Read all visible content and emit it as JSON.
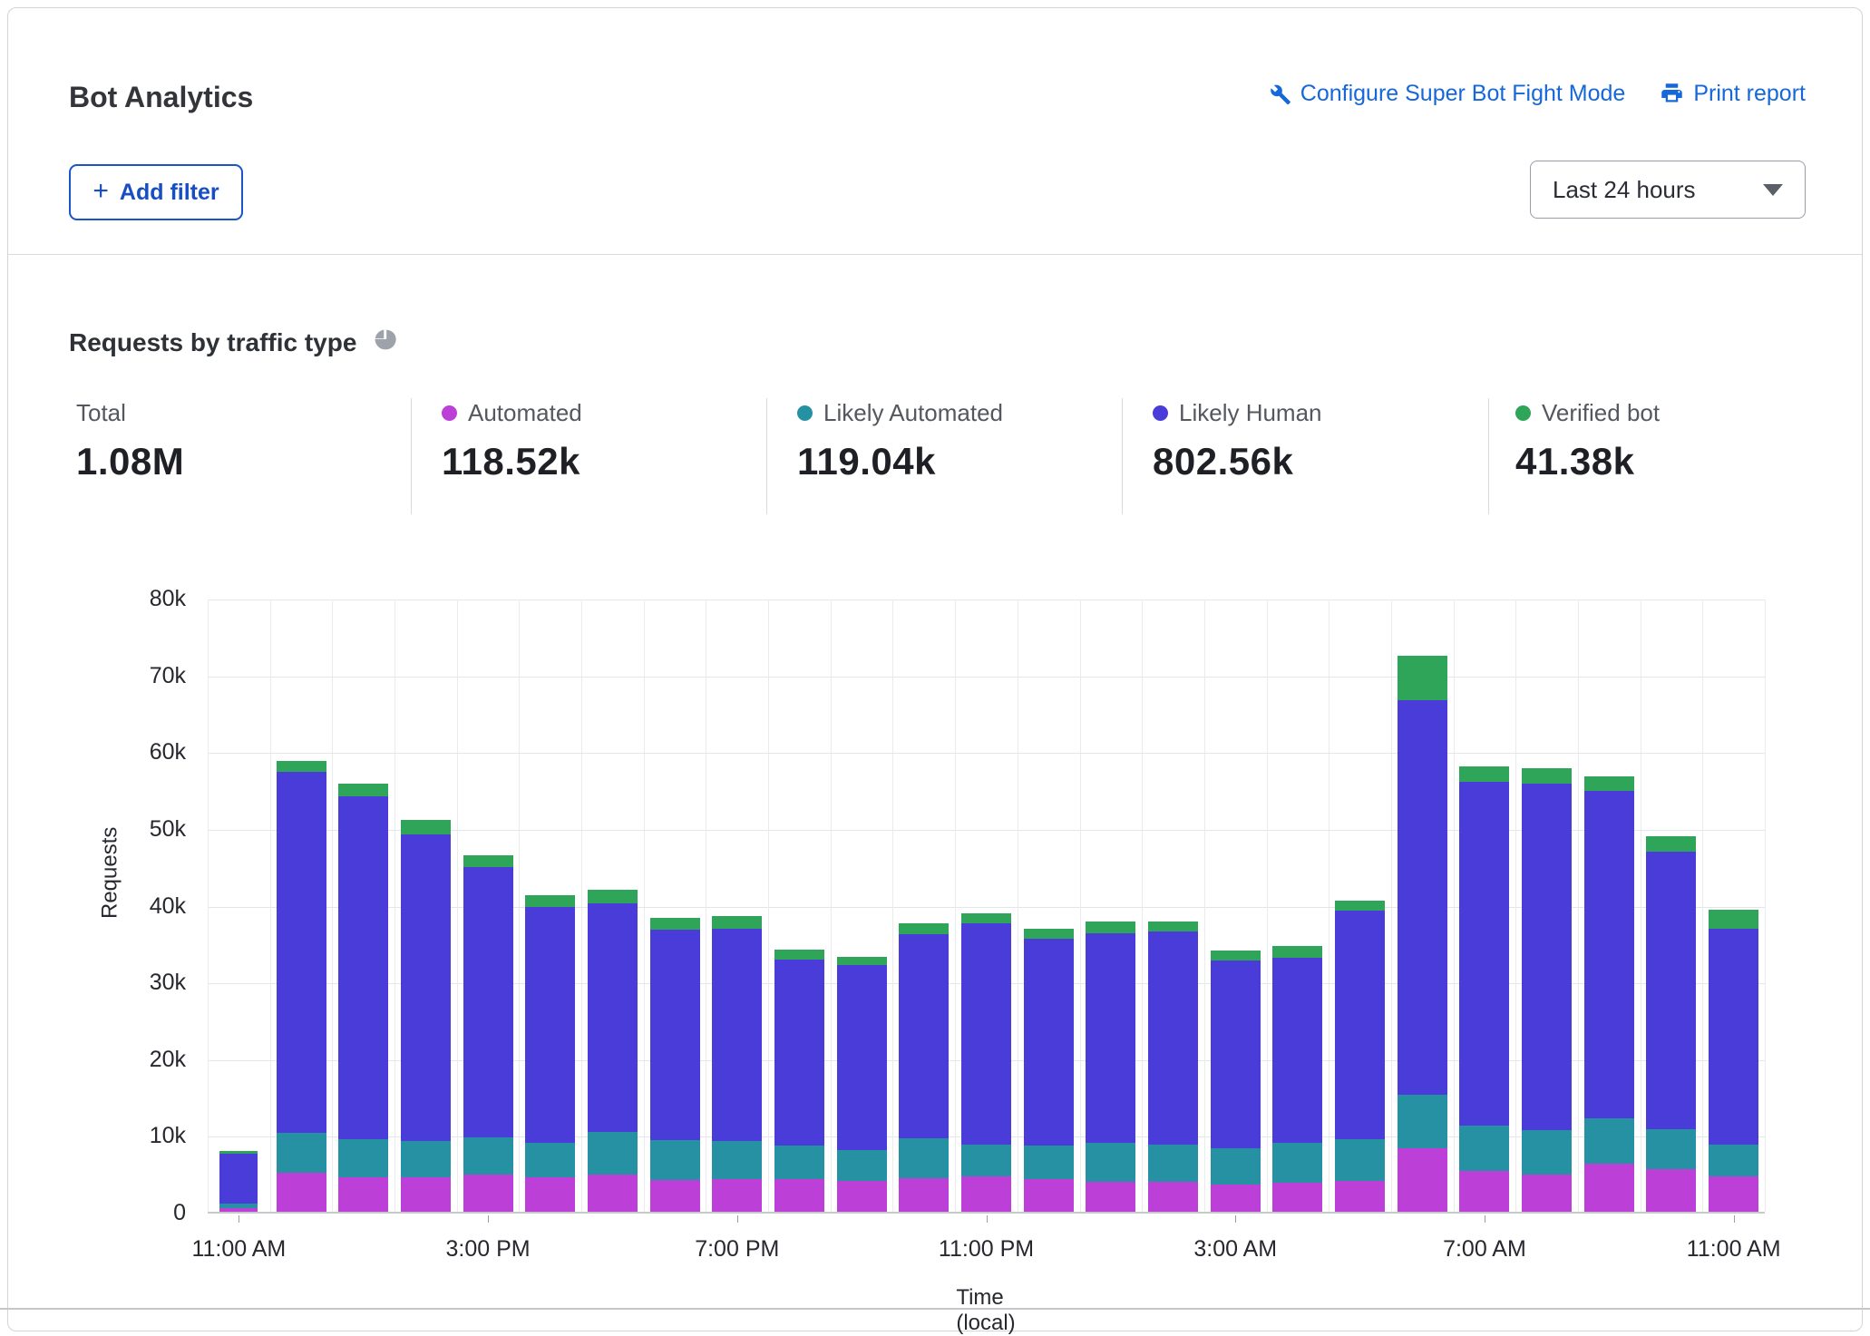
{
  "header": {
    "title": "Bot Analytics",
    "configure_link": "Configure Super Bot Fight Mode",
    "print_link": "Print report"
  },
  "filters": {
    "add_filter_plus": "+",
    "add_filter_label": "Add filter",
    "time_range_value": "Last 24 hours"
  },
  "section": {
    "title": "Requests by traffic type"
  },
  "stats": [
    {
      "label": "Total",
      "value": "1.08M",
      "color": null
    },
    {
      "label": "Automated",
      "value": "118.52k",
      "color": "#bc40d8"
    },
    {
      "label": "Likely Automated",
      "value": "119.04k",
      "color": "#2791a4"
    },
    {
      "label": "Likely Human",
      "value": "802.56k",
      "color": "#4a3cd9"
    },
    {
      "label": "Verified bot",
      "value": "41.38k",
      "color": "#2ea558"
    }
  ],
  "colors": {
    "automated": "#bc40d8",
    "likely_automated": "#2791a4",
    "likely_human": "#4a3cd9",
    "verified_bot": "#2ea558",
    "link_blue": "#1667d9",
    "button_blue": "#174ec4",
    "grid": "#e5e6e9",
    "axis_text": "#26282e"
  },
  "chart_data": {
    "type": "bar",
    "stacked": true,
    "title": "Requests by traffic type",
    "xlabel": "Time (local)",
    "ylabel": "Requests",
    "ylim": [
      0,
      80000
    ],
    "y_tick_labels": [
      "0",
      "10k",
      "20k",
      "30k",
      "40k",
      "50k",
      "60k",
      "70k",
      "80k"
    ],
    "x_tick_indices": [
      0,
      4,
      8,
      12,
      16,
      20,
      24
    ],
    "x_tick_labels": [
      "11:00 AM",
      "3:00 PM",
      "7:00 PM",
      "11:00 PM",
      "3:00 AM",
      "7:00 AM",
      "11:00 AM"
    ],
    "categories": [
      "11:00 AM",
      "12:00 PM",
      "1:00 PM",
      "2:00 PM",
      "3:00 PM",
      "4:00 PM",
      "5:00 PM",
      "6:00 PM",
      "7:00 PM",
      "8:00 PM",
      "9:00 PM",
      "10:00 PM",
      "11:00 PM",
      "12:00 AM",
      "1:00 AM",
      "2:00 AM",
      "3:00 AM",
      "4:00 AM",
      "5:00 AM",
      "6:00 AM",
      "7:00 AM",
      "8:00 AM",
      "9:00 AM",
      "10:00 AM",
      "11:00 AM"
    ],
    "unit": "thousands of requests",
    "series": [
      {
        "name": "Automated",
        "values": [
          0.5,
          5.1,
          4.5,
          4.5,
          4.8,
          4.5,
          4.8,
          4.1,
          4.3,
          4.2,
          4.0,
          4.4,
          4.6,
          4.2,
          3.9,
          3.9,
          3.6,
          3.8,
          4.0,
          8.3,
          5.3,
          4.9,
          6.3,
          5.6,
          4.6
        ]
      },
      {
        "name": "Likely Automated",
        "values": [
          0.6,
          5.2,
          5.0,
          4.7,
          4.9,
          4.5,
          5.6,
          5.2,
          4.9,
          4.4,
          4.0,
          5.2,
          4.1,
          4.4,
          5.1,
          4.9,
          4.7,
          5.2,
          5.5,
          6.9,
          5.9,
          5.7,
          5.9,
          5.2,
          4.1
        ]
      },
      {
        "name": "Likely Human",
        "values": [
          6.5,
          47.0,
          44.6,
          40.0,
          35.2,
          30.7,
          29.8,
          27.4,
          27.7,
          24.2,
          24.1,
          26.6,
          28.9,
          27.0,
          27.3,
          27.7,
          24.4,
          24.1,
          29.7,
          51.4,
          44.8,
          45.2,
          42.6,
          36.1,
          28.2
        ]
      },
      {
        "name": "Verified bot",
        "values": [
          0.3,
          1.4,
          1.7,
          1.9,
          1.5,
          1.6,
          1.7,
          1.6,
          1.6,
          1.3,
          1.1,
          1.4,
          1.3,
          1.3,
          1.5,
          1.3,
          1.3,
          1.5,
          1.3,
          5.8,
          2.0,
          2.0,
          1.9,
          2.0,
          2.5
        ]
      }
    ],
    "bar_totals_k": [
      7.9,
      58.7,
      55.8,
      51.1,
      46.4,
      41.3,
      41.9,
      38.3,
      38.5,
      34.1,
      33.2,
      37.6,
      38.9,
      36.9,
      37.8,
      37.8,
      34.0,
      34.6,
      40.5,
      72.4,
      58.0,
      57.8,
      56.7,
      48.9,
      39.4
    ]
  }
}
